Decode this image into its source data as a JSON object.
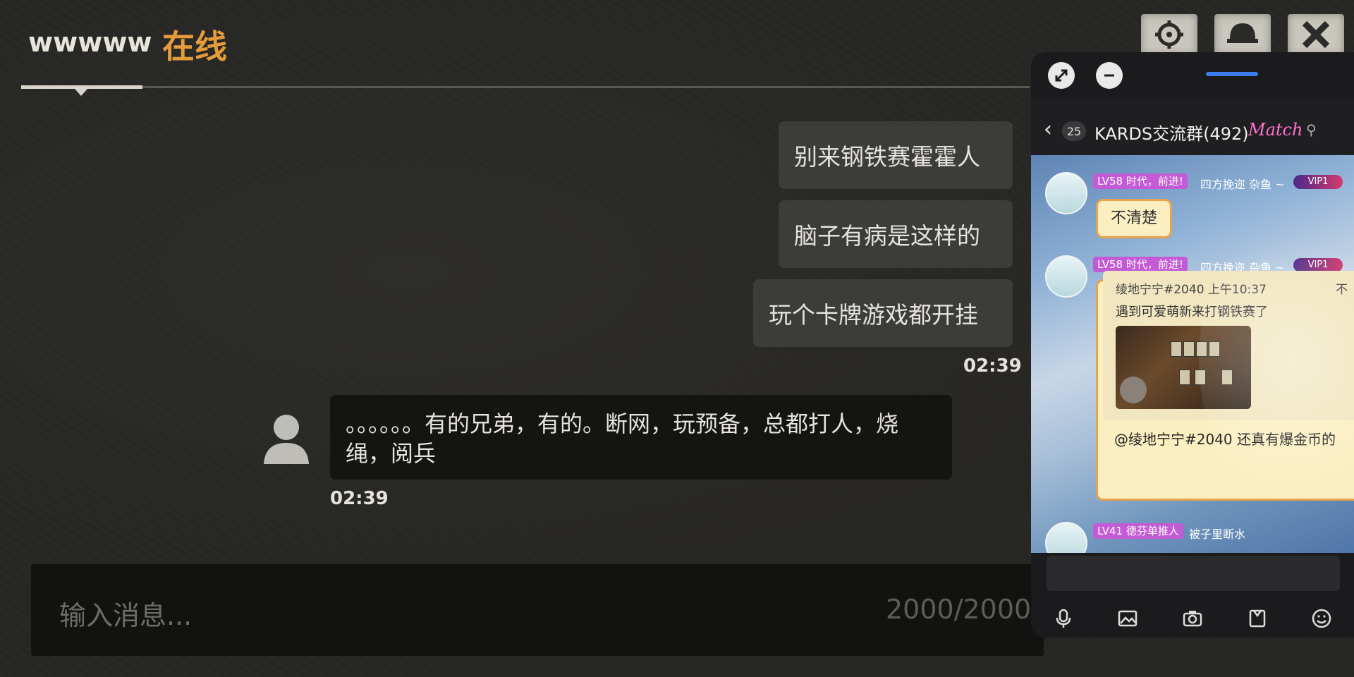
{
  "header": {
    "user_name": "wwwww",
    "status": "在线"
  },
  "top_icons": [
    "crosshair-icon",
    "helmet-icon",
    "close-icon"
  ],
  "messages": {
    "outgoing": [
      "别来钢铁赛霍霍人",
      "脑子有病是这样的",
      "玩个卡牌游戏都开挂"
    ],
    "outgoing_time": "02:39",
    "incoming": {
      "text": "。。。。。。有的兄弟，有的。断网，玩预备，总都打人，烧绳，阅兵",
      "time": "02:39"
    }
  },
  "input": {
    "placeholder": "输入消息...",
    "counter": "2000/2000"
  },
  "overlay": {
    "controls": [
      "expand-icon",
      "minimize-icon"
    ],
    "back_badge": "25",
    "group_title": "KARDS交流群(492)",
    "match_badge": "Match",
    "messages": [
      {
        "level": "LV58",
        "title": "时代，前进!",
        "meta": "四方挽迩  杂鱼 ~",
        "vip": "VIP1",
        "text": "不清楚"
      },
      {
        "level": "LV58",
        "title": "时代，前进!",
        "meta": "四方挽迩  杂鱼 ~",
        "vip": "VIP1",
        "quote_meta": "绫地宁宁#2040 上午10:37",
        "quote_extra": "不",
        "quote_text": "遇到可爱萌新来打钢铁赛了",
        "reply": "@绫地宁宁#2040 还真有爆金币的"
      },
      {
        "level": "LV41",
        "title": "德芬单推人",
        "meta": "被子里断水"
      }
    ],
    "toolbar": [
      "microphone-icon",
      "image-icon",
      "camera-icon",
      "file-icon",
      "emoji-icon"
    ]
  }
}
